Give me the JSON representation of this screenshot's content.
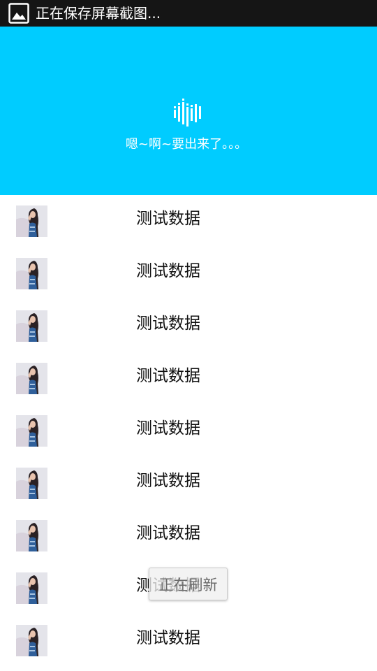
{
  "status_bar": {
    "icon": "image-icon",
    "text": "正在保存屏幕截图..."
  },
  "refresh_header": {
    "background_color": "#00ccff",
    "icon": "sound-wave-icon",
    "text": "嗯~啊~要出来了。。。"
  },
  "list": {
    "items": [
      {
        "thumbnail": "avatar-photo",
        "label": "测试数据"
      },
      {
        "thumbnail": "avatar-photo",
        "label": "测试数据"
      },
      {
        "thumbnail": "avatar-photo",
        "label": "测试数据"
      },
      {
        "thumbnail": "avatar-photo",
        "label": "测试数据"
      },
      {
        "thumbnail": "avatar-photo",
        "label": "测试数据"
      },
      {
        "thumbnail": "avatar-photo",
        "label": "测试数据"
      },
      {
        "thumbnail": "avatar-photo",
        "label": "测试数据"
      },
      {
        "thumbnail": "avatar-photo",
        "label": "测试数据"
      },
      {
        "thumbnail": "avatar-photo",
        "label": "测试数据"
      }
    ]
  },
  "toast": {
    "text": "正在刷新"
  }
}
